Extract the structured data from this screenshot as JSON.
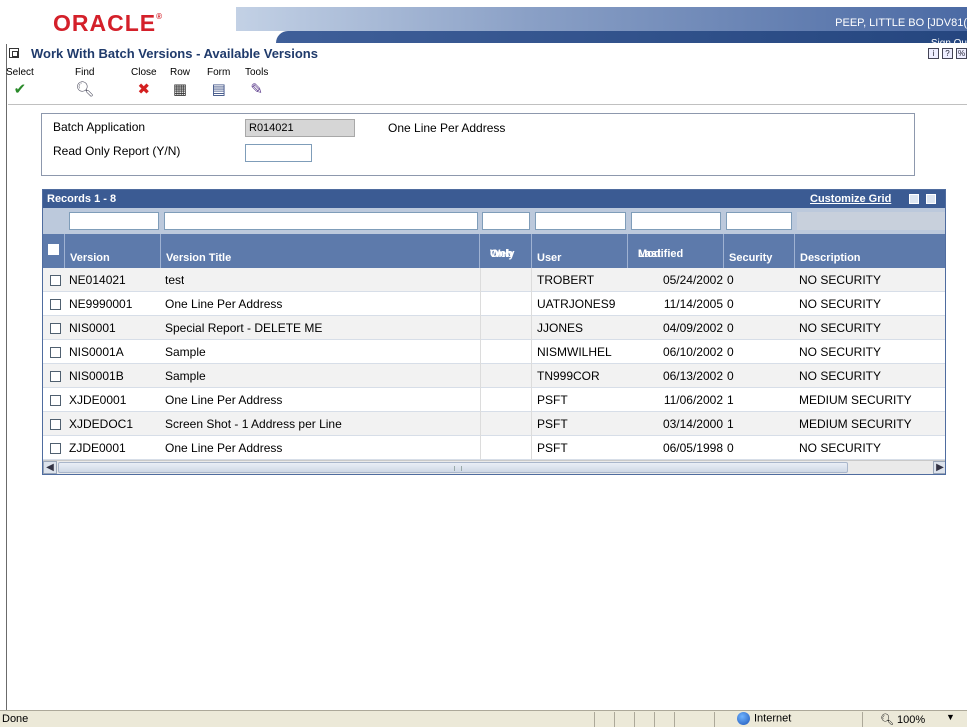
{
  "header": {
    "logo": "ORACLE",
    "logo_mark": "®",
    "user": "PEEP, LITTLE BO  [JDV81(",
    "sign_out": "Sign Ou"
  },
  "page": {
    "title": "Work With Batch Versions - Available Versions",
    "icons": [
      "info-icon",
      "help-icon",
      "about-icon"
    ]
  },
  "toolbar": {
    "select": "Select",
    "find": "Find",
    "close": "Close",
    "row": "Row",
    "form": "Form",
    "tools": "Tools"
  },
  "form": {
    "batch_app_label": "Batch Application",
    "batch_app_value": "R014021",
    "batch_app_desc": "One Line Per Address",
    "read_only_label": "Read Only Report (Y/N)",
    "read_only_value": ""
  },
  "grid": {
    "records_label": "Records 1 - 8",
    "customize_label": "Customize Grid",
    "columns": {
      "version": "Version",
      "version_title": "Version Title",
      "web_only_1": "Web",
      "web_only_2": "Only",
      "user": "User",
      "last_modified_1": "Last",
      "last_modified_2": "Modified",
      "security": "Security",
      "description": "Description"
    },
    "rows": [
      {
        "version": "NE014021",
        "title": "test",
        "web": "",
        "user": "TROBERT",
        "modified": "05/24/2002",
        "security": "0",
        "description": "NO SECURITY"
      },
      {
        "version": "NE9990001",
        "title": "One Line Per Address",
        "web": "",
        "user": "UATRJONES9",
        "modified": "11/14/2005",
        "security": "0",
        "description": "NO SECURITY"
      },
      {
        "version": "NIS0001",
        "title": "Special Report - DELETE ME",
        "web": "",
        "user": "JJONES",
        "modified": "04/09/2002",
        "security": "0",
        "description": "NO SECURITY"
      },
      {
        "version": "NIS0001A",
        "title": "Sample",
        "web": "",
        "user": "NISMWILHEL",
        "modified": "06/10/2002",
        "security": "0",
        "description": "NO SECURITY"
      },
      {
        "version": "NIS0001B",
        "title": "Sample",
        "web": "",
        "user": "TN999COR",
        "modified": "06/13/2002",
        "security": "0",
        "description": "NO SECURITY"
      },
      {
        "version": "XJDE0001",
        "title": "One Line Per Address",
        "web": "",
        "user": "PSFT",
        "modified": "11/06/2002",
        "security": "1",
        "description": "MEDIUM SECURITY"
      },
      {
        "version": "XJDEDOC1",
        "title": "Screen Shot - 1 Address per Line",
        "web": "",
        "user": "PSFT",
        "modified": "03/14/2000",
        "security": "1",
        "description": "MEDIUM SECURITY"
      },
      {
        "version": "ZJDE0001",
        "title": "One Line Per Address",
        "web": "",
        "user": "PSFT",
        "modified": "06/05/1998",
        "security": "0",
        "description": "NO SECURITY"
      }
    ]
  },
  "statusbar": {
    "status": "Done",
    "zone": "Internet",
    "zoom": "100%"
  },
  "colors": {
    "oracle_red": "#d4202a",
    "grid_header": "#3b5b93",
    "column_header": "#5d7aab",
    "title_blue": "#1f3a6b"
  }
}
